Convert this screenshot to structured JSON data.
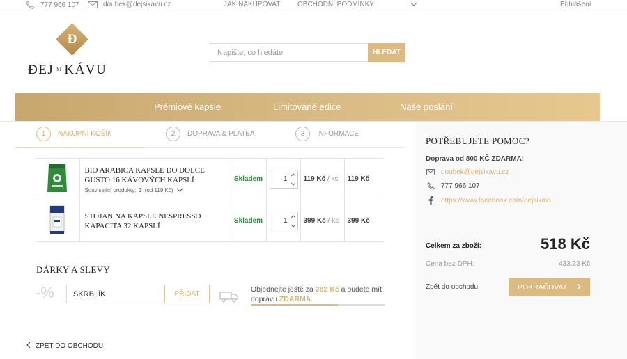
{
  "topbar": {
    "phone": "777 966 107",
    "email": "doubek@dejsikavu.cz",
    "how_to_buy": "JAK NAKUPOVAT",
    "terms": "OBCHODNÍ PODMÍNKY",
    "login": "Přihlášení"
  },
  "logo": {
    "mark": "Đ",
    "word1": "ĐEJ",
    "word2": "SI",
    "word3": "KÁVU"
  },
  "search": {
    "placeholder": "Napište, co hledáte",
    "button": "HLEDAT"
  },
  "nav": {
    "items": [
      "Prémiové kapsle",
      "Limitované edice",
      "Naše poslání"
    ]
  },
  "steps": [
    {
      "num": "1",
      "label": "NÁKUPNÍ KOŠÍK"
    },
    {
      "num": "2",
      "label": "DOPRAVA & PLATBA"
    },
    {
      "num": "3",
      "label": "INFORMACE"
    }
  ],
  "cart": {
    "items": [
      {
        "name": "BIO ARABICA KAPSLE DO DOLCE GUSTO 16 KÁVOVÝCH KAPSLÍ",
        "related_label": "Související produkty:",
        "related_count": "3",
        "related_price": "(od 119 Kč)",
        "stock": "Skladem",
        "qty": "1",
        "unit_price": "119 Kč",
        "per_unit": "/ ks",
        "total": "119 Kč"
      },
      {
        "name": "STOJAN NA KAPSLE NESPRESSO KAPACITA 32 KAPSLÍ",
        "stock": "Skladem",
        "qty": "1",
        "unit_price": "399 Kč",
        "per_unit": "/ ks",
        "total": "399 Kč"
      }
    ]
  },
  "discounts": {
    "title": "DÁRKY A SLEVY",
    "percent": "-%",
    "coupon_value": "SKRBLÍK",
    "apply_button": "PŘIDAT",
    "ship_text_1": "Objednejte ještě za",
    "ship_remaining": "282 Kč",
    "ship_text_2": "a budete mít dopravu",
    "ship_free": "ZDARMA",
    "ship_text_3": ".",
    "progress": 0.65
  },
  "back_link": "ZPĚT DO OBCHODU",
  "help": {
    "title": "POTŘEBUJETE POMOC?",
    "free_shipping": "Doprava od 800 KČ ZDARMA!",
    "email": "doubek@dejsikavu.cz",
    "phone": "777 966 107",
    "facebook": "https://www.facebook.com/dejsikavu"
  },
  "summary": {
    "total_label": "Celkem za zboží:",
    "total_value": "518 Kč",
    "net_label": "Cena bez DPH:",
    "net_value": "433,23 Kč",
    "back_to_shop": "Zpět do obchodu",
    "continue": "POKRAČOVAT"
  },
  "colors": {
    "gold": "#dcbb83",
    "in_stock": "#179a2b",
    "text": "#333333"
  }
}
